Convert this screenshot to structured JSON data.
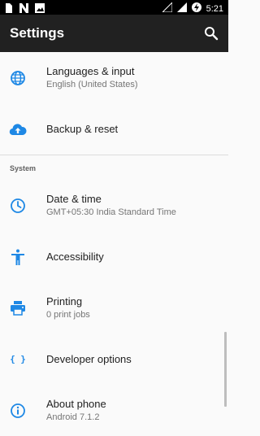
{
  "status_bar": {
    "time": "5:21",
    "left_icons": [
      "sim-icon",
      "n-app-icon",
      "image-icon"
    ],
    "right_icons": [
      "no-signal-icon",
      "cellular-icon",
      "battery-charging-icon"
    ]
  },
  "toolbar": {
    "title": "Settings",
    "search_icon": "search-icon"
  },
  "items": [
    {
      "title": "Languages & input",
      "summary": "English (United States)",
      "icon": "globe-icon"
    },
    {
      "title": "Backup & reset",
      "summary": "",
      "icon": "cloud-upload-icon"
    }
  ],
  "section": {
    "header": "System"
  },
  "system_items": [
    {
      "title": "Date & time",
      "summary": "GMT+05:30 India Standard Time",
      "icon": "clock-icon"
    },
    {
      "title": "Accessibility",
      "summary": "",
      "icon": "accessibility-icon"
    },
    {
      "title": "Printing",
      "summary": "0 print jobs",
      "icon": "printer-icon"
    },
    {
      "title": "Developer options",
      "summary": "",
      "icon": "braces-icon",
      "icon_text": "{ }"
    },
    {
      "title": "About phone",
      "summary": "Android 7.1.2",
      "icon": "info-icon"
    }
  ],
  "colors": {
    "accent": "#1e88e5",
    "toolbar": "#212121",
    "background": "#fafafa"
  }
}
